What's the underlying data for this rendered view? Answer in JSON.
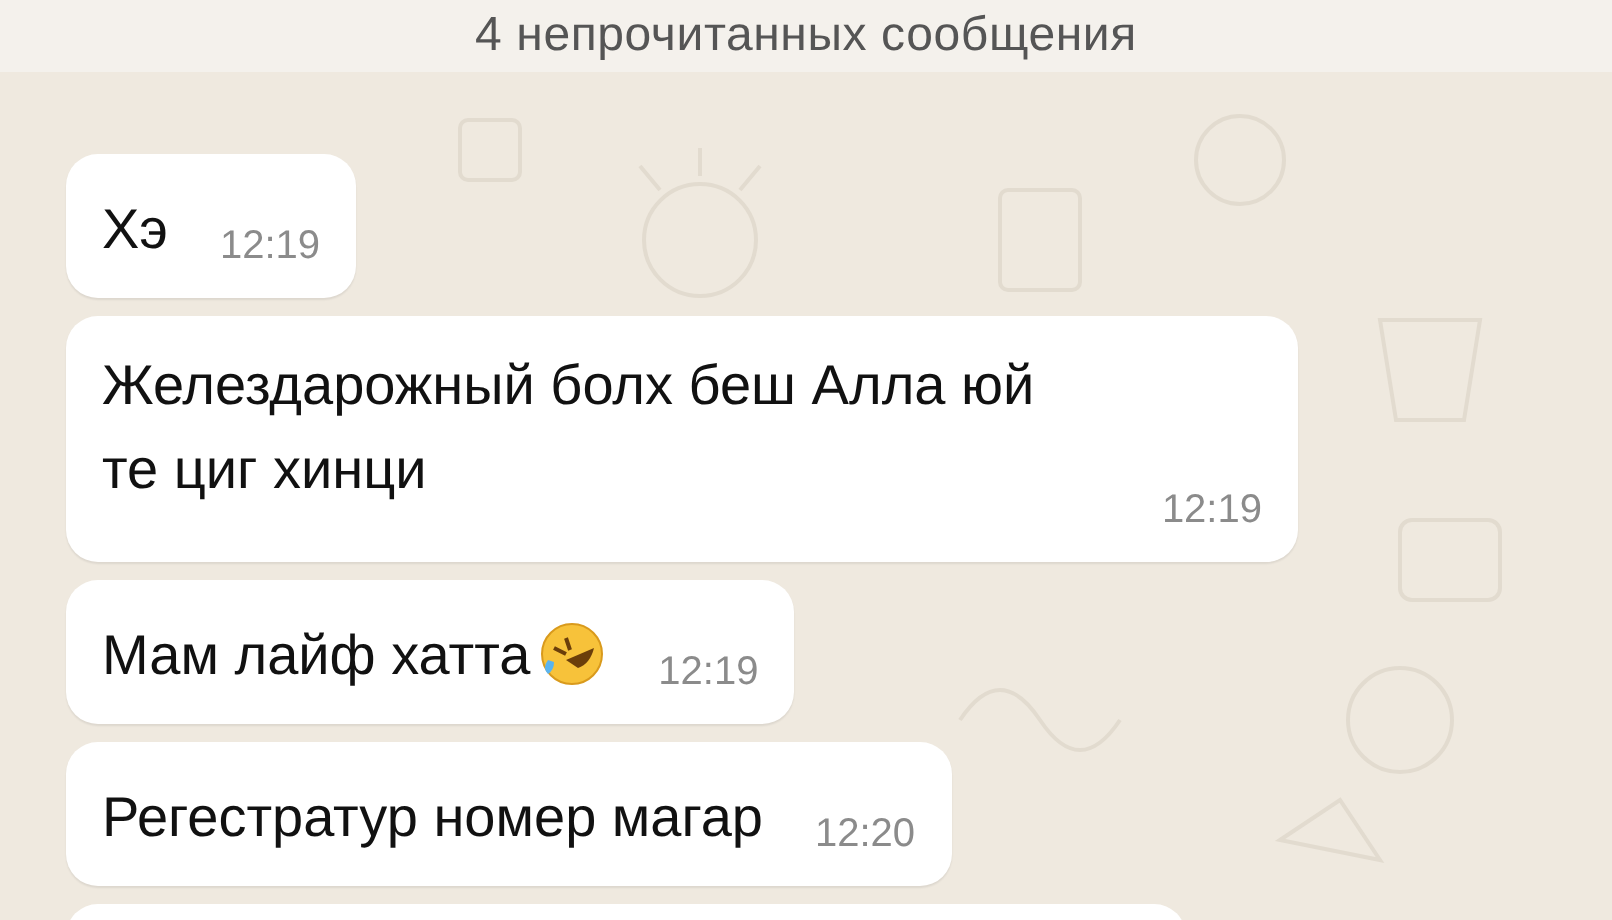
{
  "banner": {
    "text": "4 непрочитанных сообщения"
  },
  "messages": [
    {
      "text": "Хэ",
      "time": "12:19",
      "emoji": false
    },
    {
      "text": "Желездарожный болх беш Алла юй те циг хинци",
      "time": "12:19",
      "emoji": false
    },
    {
      "text": "Мам лайф хатта",
      "time": "12:19",
      "emoji": true
    },
    {
      "text": "Регестратур номер магар",
      "time": "12:20",
      "emoji": false
    }
  ]
}
